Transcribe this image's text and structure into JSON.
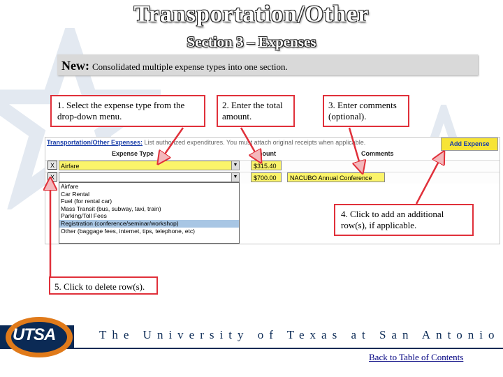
{
  "slide": {
    "title": "Transportation/Other",
    "subtitle": "Section 3 – Expenses",
    "new_label": "New:",
    "new_text": "Consolidated multiple expense types into one section."
  },
  "callouts": {
    "c1": "1. Select the expense type from the drop-down menu.",
    "c2": "2. Enter the total amount.",
    "c3": "3. Enter comments (optional).",
    "c4": "4. Click to add an additional row(s), if applicable.",
    "c5": "5. Click to delete row(s)."
  },
  "form": {
    "section_link": "Transportation/Other Expenses:",
    "instructions": "List authorized expenditures. You must attach original receipts when applicable.",
    "add_button": "Add Expense",
    "col_type": "Expense Type",
    "col_amount": "Amount",
    "col_comments": "Comments",
    "delete_label": "X",
    "rows": [
      {
        "type": "Airfare",
        "amount": "$315.40",
        "comment": ""
      },
      {
        "type": "",
        "amount": "$700.00",
        "comment": "NACUBO Annual Conference"
      }
    ],
    "dropdown_options": [
      "Airfare",
      "Car Rental",
      "Fuel (for rental car)",
      "Mass Transit (bus, subway, taxi, train)",
      "Parking/Toll Fees",
      "Registration (conference/seminar/workshop)",
      "Other (baggage fees, internet, tips, telephone, etc)"
    ],
    "dropdown_selected": "Registration (conference/seminar/workshop)"
  },
  "footer": {
    "logo_text": "UTSA",
    "university": "The University of Texas at San Antonio",
    "back_link": "Back to Table of Contents"
  },
  "colors": {
    "callout_border": "#e0303a",
    "field_highlight": "#fbf46a",
    "footer_navy": "#0b2a55",
    "link_blue": "#1a3ea8"
  }
}
